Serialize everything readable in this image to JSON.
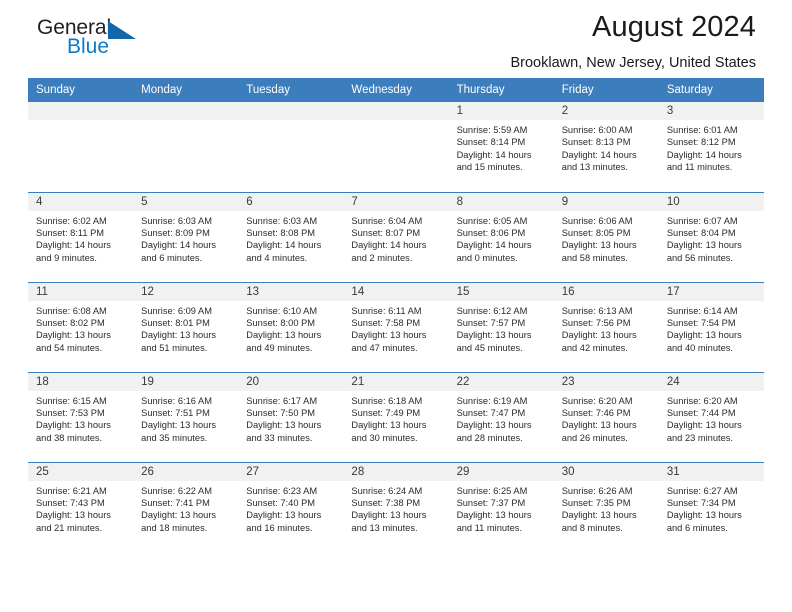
{
  "logo": {
    "word_one": "General",
    "word_two": "Blue",
    "triangle_color": "#1167a8",
    "blue_color": "#0d7bc4"
  },
  "header": {
    "title": "August 2024",
    "subtitle": "Brooklawn, New Jersey, United States",
    "header_bg": "#3c7ebd",
    "daynum_bg": "#f1f1f1"
  },
  "calendar": {
    "weekday_headers": [
      "Sunday",
      "Monday",
      "Tuesday",
      "Wednesday",
      "Thursday",
      "Friday",
      "Saturday"
    ],
    "weeks": [
      [
        {
          "day": "",
          "empty": true,
          "sunrise": "",
          "sunset": "",
          "daylight_line1": "",
          "daylight_line2": ""
        },
        {
          "day": "",
          "empty": true,
          "sunrise": "",
          "sunset": "",
          "daylight_line1": "",
          "daylight_line2": ""
        },
        {
          "day": "",
          "empty": true,
          "sunrise": "",
          "sunset": "",
          "daylight_line1": "",
          "daylight_line2": ""
        },
        {
          "day": "",
          "empty": true,
          "sunrise": "",
          "sunset": "",
          "daylight_line1": "",
          "daylight_line2": ""
        },
        {
          "day": "1",
          "empty": false,
          "sunrise": "Sunrise: 5:59 AM",
          "sunset": "Sunset: 8:14 PM",
          "daylight_line1": "Daylight: 14 hours",
          "daylight_line2": "and 15 minutes."
        },
        {
          "day": "2",
          "empty": false,
          "sunrise": "Sunrise: 6:00 AM",
          "sunset": "Sunset: 8:13 PM",
          "daylight_line1": "Daylight: 14 hours",
          "daylight_line2": "and 13 minutes."
        },
        {
          "day": "3",
          "empty": false,
          "sunrise": "Sunrise: 6:01 AM",
          "sunset": "Sunset: 8:12 PM",
          "daylight_line1": "Daylight: 14 hours",
          "daylight_line2": "and 11 minutes."
        }
      ],
      [
        {
          "day": "4",
          "empty": false,
          "sunrise": "Sunrise: 6:02 AM",
          "sunset": "Sunset: 8:11 PM",
          "daylight_line1": "Daylight: 14 hours",
          "daylight_line2": "and 9 minutes."
        },
        {
          "day": "5",
          "empty": false,
          "sunrise": "Sunrise: 6:03 AM",
          "sunset": "Sunset: 8:09 PM",
          "daylight_line1": "Daylight: 14 hours",
          "daylight_line2": "and 6 minutes."
        },
        {
          "day": "6",
          "empty": false,
          "sunrise": "Sunrise: 6:03 AM",
          "sunset": "Sunset: 8:08 PM",
          "daylight_line1": "Daylight: 14 hours",
          "daylight_line2": "and 4 minutes."
        },
        {
          "day": "7",
          "empty": false,
          "sunrise": "Sunrise: 6:04 AM",
          "sunset": "Sunset: 8:07 PM",
          "daylight_line1": "Daylight: 14 hours",
          "daylight_line2": "and 2 minutes."
        },
        {
          "day": "8",
          "empty": false,
          "sunrise": "Sunrise: 6:05 AM",
          "sunset": "Sunset: 8:06 PM",
          "daylight_line1": "Daylight: 14 hours",
          "daylight_line2": "and 0 minutes."
        },
        {
          "day": "9",
          "empty": false,
          "sunrise": "Sunrise: 6:06 AM",
          "sunset": "Sunset: 8:05 PM",
          "daylight_line1": "Daylight: 13 hours",
          "daylight_line2": "and 58 minutes."
        },
        {
          "day": "10",
          "empty": false,
          "sunrise": "Sunrise: 6:07 AM",
          "sunset": "Sunset: 8:04 PM",
          "daylight_line1": "Daylight: 13 hours",
          "daylight_line2": "and 56 minutes."
        }
      ],
      [
        {
          "day": "11",
          "empty": false,
          "sunrise": "Sunrise: 6:08 AM",
          "sunset": "Sunset: 8:02 PM",
          "daylight_line1": "Daylight: 13 hours",
          "daylight_line2": "and 54 minutes."
        },
        {
          "day": "12",
          "empty": false,
          "sunrise": "Sunrise: 6:09 AM",
          "sunset": "Sunset: 8:01 PM",
          "daylight_line1": "Daylight: 13 hours",
          "daylight_line2": "and 51 minutes."
        },
        {
          "day": "13",
          "empty": false,
          "sunrise": "Sunrise: 6:10 AM",
          "sunset": "Sunset: 8:00 PM",
          "daylight_line1": "Daylight: 13 hours",
          "daylight_line2": "and 49 minutes."
        },
        {
          "day": "14",
          "empty": false,
          "sunrise": "Sunrise: 6:11 AM",
          "sunset": "Sunset: 7:58 PM",
          "daylight_line1": "Daylight: 13 hours",
          "daylight_line2": "and 47 minutes."
        },
        {
          "day": "15",
          "empty": false,
          "sunrise": "Sunrise: 6:12 AM",
          "sunset": "Sunset: 7:57 PM",
          "daylight_line1": "Daylight: 13 hours",
          "daylight_line2": "and 45 minutes."
        },
        {
          "day": "16",
          "empty": false,
          "sunrise": "Sunrise: 6:13 AM",
          "sunset": "Sunset: 7:56 PM",
          "daylight_line1": "Daylight: 13 hours",
          "daylight_line2": "and 42 minutes."
        },
        {
          "day": "17",
          "empty": false,
          "sunrise": "Sunrise: 6:14 AM",
          "sunset": "Sunset: 7:54 PM",
          "daylight_line1": "Daylight: 13 hours",
          "daylight_line2": "and 40 minutes."
        }
      ],
      [
        {
          "day": "18",
          "empty": false,
          "sunrise": "Sunrise: 6:15 AM",
          "sunset": "Sunset: 7:53 PM",
          "daylight_line1": "Daylight: 13 hours",
          "daylight_line2": "and 38 minutes."
        },
        {
          "day": "19",
          "empty": false,
          "sunrise": "Sunrise: 6:16 AM",
          "sunset": "Sunset: 7:51 PM",
          "daylight_line1": "Daylight: 13 hours",
          "daylight_line2": "and 35 minutes."
        },
        {
          "day": "20",
          "empty": false,
          "sunrise": "Sunrise: 6:17 AM",
          "sunset": "Sunset: 7:50 PM",
          "daylight_line1": "Daylight: 13 hours",
          "daylight_line2": "and 33 minutes."
        },
        {
          "day": "21",
          "empty": false,
          "sunrise": "Sunrise: 6:18 AM",
          "sunset": "Sunset: 7:49 PM",
          "daylight_line1": "Daylight: 13 hours",
          "daylight_line2": "and 30 minutes."
        },
        {
          "day": "22",
          "empty": false,
          "sunrise": "Sunrise: 6:19 AM",
          "sunset": "Sunset: 7:47 PM",
          "daylight_line1": "Daylight: 13 hours",
          "daylight_line2": "and 28 minutes."
        },
        {
          "day": "23",
          "empty": false,
          "sunrise": "Sunrise: 6:20 AM",
          "sunset": "Sunset: 7:46 PM",
          "daylight_line1": "Daylight: 13 hours",
          "daylight_line2": "and 26 minutes."
        },
        {
          "day": "24",
          "empty": false,
          "sunrise": "Sunrise: 6:20 AM",
          "sunset": "Sunset: 7:44 PM",
          "daylight_line1": "Daylight: 13 hours",
          "daylight_line2": "and 23 minutes."
        }
      ],
      [
        {
          "day": "25",
          "empty": false,
          "sunrise": "Sunrise: 6:21 AM",
          "sunset": "Sunset: 7:43 PM",
          "daylight_line1": "Daylight: 13 hours",
          "daylight_line2": "and 21 minutes."
        },
        {
          "day": "26",
          "empty": false,
          "sunrise": "Sunrise: 6:22 AM",
          "sunset": "Sunset: 7:41 PM",
          "daylight_line1": "Daylight: 13 hours",
          "daylight_line2": "and 18 minutes."
        },
        {
          "day": "27",
          "empty": false,
          "sunrise": "Sunrise: 6:23 AM",
          "sunset": "Sunset: 7:40 PM",
          "daylight_line1": "Daylight: 13 hours",
          "daylight_line2": "and 16 minutes."
        },
        {
          "day": "28",
          "empty": false,
          "sunrise": "Sunrise: 6:24 AM",
          "sunset": "Sunset: 7:38 PM",
          "daylight_line1": "Daylight: 13 hours",
          "daylight_line2": "and 13 minutes."
        },
        {
          "day": "29",
          "empty": false,
          "sunrise": "Sunrise: 6:25 AM",
          "sunset": "Sunset: 7:37 PM",
          "daylight_line1": "Daylight: 13 hours",
          "daylight_line2": "and 11 minutes."
        },
        {
          "day": "30",
          "empty": false,
          "sunrise": "Sunrise: 6:26 AM",
          "sunset": "Sunset: 7:35 PM",
          "daylight_line1": "Daylight: 13 hours",
          "daylight_line2": "and 8 minutes."
        },
        {
          "day": "31",
          "empty": false,
          "sunrise": "Sunrise: 6:27 AM",
          "sunset": "Sunset: 7:34 PM",
          "daylight_line1": "Daylight: 13 hours",
          "daylight_line2": "and 6 minutes."
        }
      ]
    ]
  }
}
